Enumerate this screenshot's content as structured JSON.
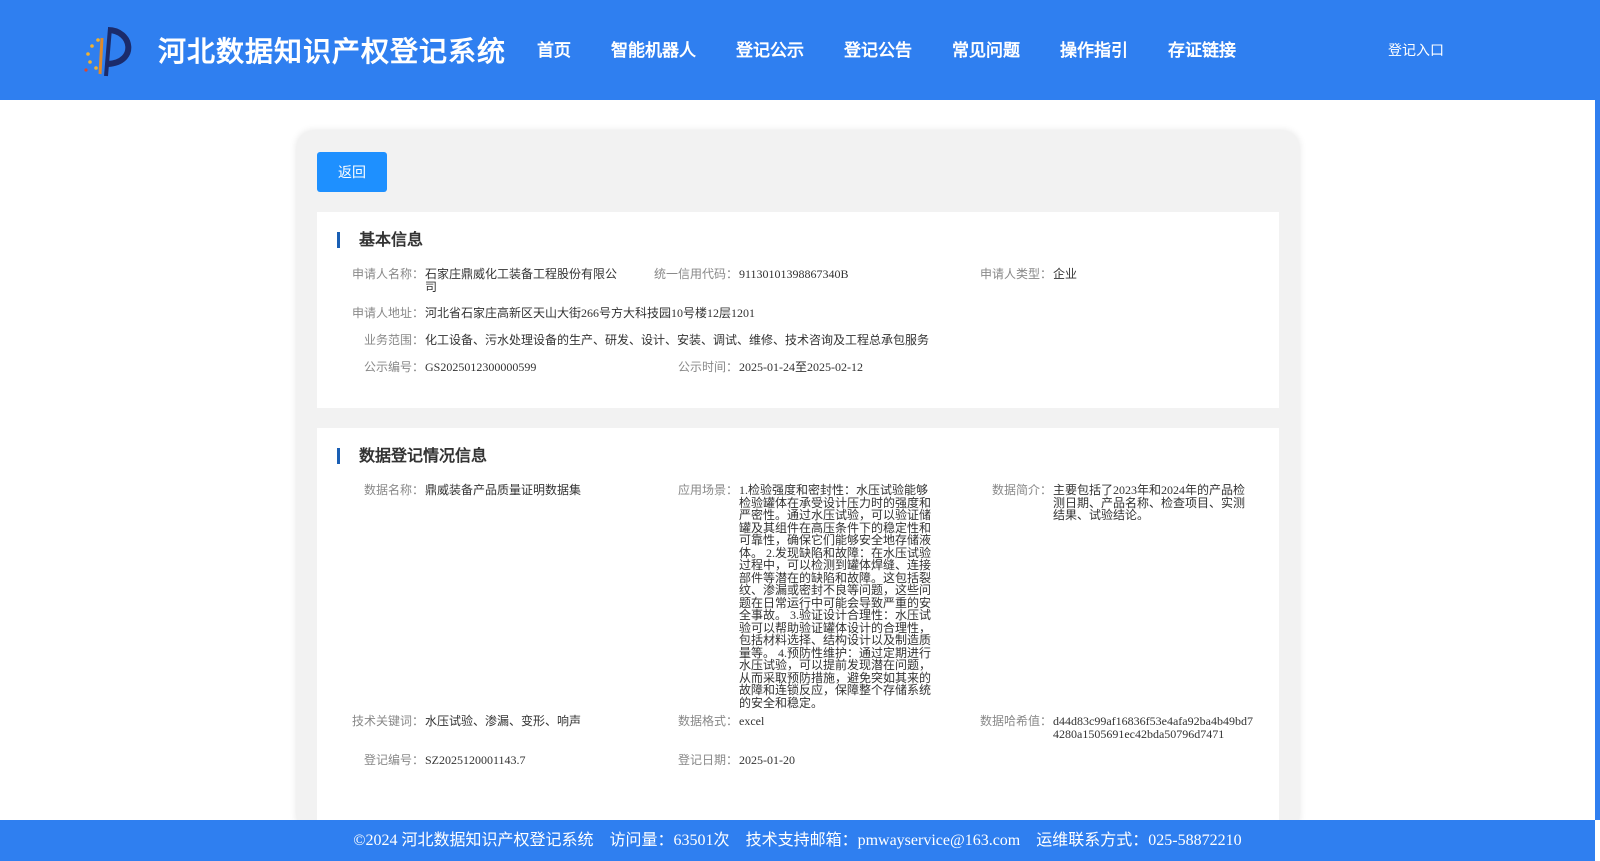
{
  "header": {
    "site_title": "河北数据知识产权登记系统",
    "logo_icon": "site-logo-icon",
    "nav": [
      "首页",
      "智能机器人",
      "登记公示",
      "登记公告",
      "常见问题",
      "操作指引",
      "存证链接"
    ],
    "login": "登记入口"
  },
  "colors": {
    "header_bg": "#2f7ff0",
    "button_bg": "#1e90ff",
    "section_bar": "#1a5fb4"
  },
  "back_button": "返回",
  "basic": {
    "title": "基本信息",
    "applicant_name_label": "申请人名称：",
    "applicant_name": "石家庄鼎威化工装备工程股份有限公司",
    "credit_code_label": "统一信用代码：",
    "credit_code": "91130101398867340B",
    "applicant_type_label": "申请人类型：",
    "applicant_type": "企业",
    "address_label": "申请人地址：",
    "address": "河北省石家庄高新区天山大街266号方大科技园10号楼12层1201",
    "scope_label": "业务范围：",
    "scope": "化工设备、污水处理设备的生产、研发、设计、安装、调试、维修、技术咨询及工程总承包服务",
    "pub_no_label": "公示编号：",
    "pub_no": "GS2025012300000599",
    "pub_time_label": "公示时间：",
    "pub_time": "2025-01-24至2025-02-12"
  },
  "data_info": {
    "title": "数据登记情况信息",
    "name_label": "数据名称：",
    "name": "鼎威装备产品质量证明数据集",
    "scene_label": "应用场景：",
    "scene": "1.检验强度和密封性：水压试验能够检验罐体在承受设计压力时的强度和严密性。通过水压试验，可以验证储罐及其组件在高压条件下的稳定性和可靠性，确保它们能够安全地存储液体。 2.发现缺陷和故障：在水压试验过程中，可以检测到罐体焊缝、连接部件等潜在的缺陷和故障。这包括裂纹、渗漏或密封不良等问题，这些问题在日常运行中可能会导致严重的安全事故。 3.验证设计合理性：水压试验可以帮助验证罐体设计的合理性，包括材料选择、结构设计以及制造质量等。 4.预防性维护：通过定期进行水压试验，可以提前发现潜在问题，从而采取预防措施，避免突如其来的故障和连锁反应，保障整个存储系统的安全和稳定。",
    "intro_label": "数据简介：",
    "intro": "主要包括了2023年和2024年的产品检测日期、产品名称、检查项目、实测结果、试验结论。",
    "keywords_label": "技术关键词：",
    "keywords": "水压试验、渗漏、变形、响声",
    "format_label": "数据格式：",
    "format": "excel",
    "hash_label": "数据哈希值：",
    "hash": "d44d83c99af16836f53e4afa92ba4b49bd74280a1505691ec42bda50796d7471",
    "reg_no_label": "登记编号：",
    "reg_no": "SZ2025120001143.7",
    "reg_date_label": "登记日期：",
    "reg_date": "2025-01-20"
  },
  "footer": {
    "copyright": "©2024 河北数据知识产权登记系统",
    "visits": "访问量：63501次",
    "email": "技术支持邮箱：pmwayservice@163.com",
    "phone": "运维联系方式：025-58872210"
  }
}
